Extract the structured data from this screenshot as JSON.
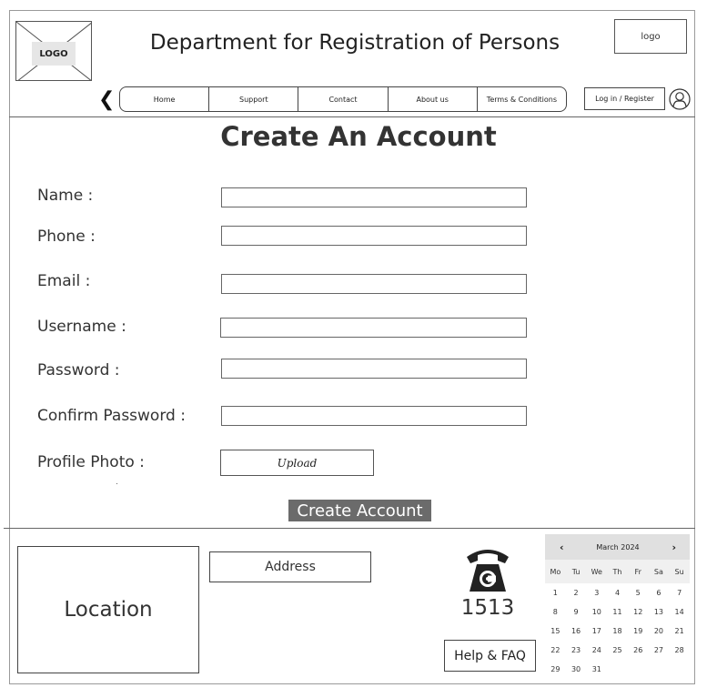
{
  "header": {
    "logo_label": "LOGO",
    "title": "Department for Registration of Persons",
    "small_logo_label": "logo",
    "login_label": "Log in / Register"
  },
  "nav": {
    "items": [
      "Home",
      "Support",
      "Contact",
      "About us",
      "Terms & Conditions"
    ]
  },
  "form": {
    "title": "Create An Account",
    "fields": [
      {
        "label": "Name :",
        "value": ""
      },
      {
        "label": "Phone :",
        "value": ""
      },
      {
        "label": "Email :",
        "value": ""
      },
      {
        "label": "Username :",
        "value": ""
      },
      {
        "label": "Password :",
        "value": ""
      },
      {
        "label": "Confirm Password :",
        "value": ""
      }
    ],
    "photo_label": "Profile Photo :",
    "upload_label": "Upload",
    "submit_label": "Create Account"
  },
  "footer": {
    "location_label": "Location",
    "address_label": "Address",
    "phone_number": "1513",
    "help_label": "Help & FAQ",
    "calendar": {
      "month_label": "March 2024",
      "prev_icon": "chevron-left-icon",
      "next_icon": "chevron-right-icon",
      "weekdays": [
        "Mo",
        "Tu",
        "We",
        "Th",
        "Fr",
        "Sa",
        "Su"
      ],
      "weeks": [
        [
          "1",
          "2",
          "3",
          "4",
          "5",
          "6",
          "7"
        ],
        [
          "8",
          "9",
          "10",
          "11",
          "12",
          "13",
          "14"
        ],
        [
          "15",
          "16",
          "17",
          "18",
          "19",
          "20",
          "21"
        ],
        [
          "22",
          "23",
          "24",
          "25",
          "26",
          "27",
          "28"
        ],
        [
          "29",
          "30",
          "31",
          "",
          "",
          "",
          ""
        ]
      ]
    }
  },
  "icons": {
    "back": "chevron-left-icon",
    "user": "user-icon",
    "phone": "telephone-icon"
  }
}
